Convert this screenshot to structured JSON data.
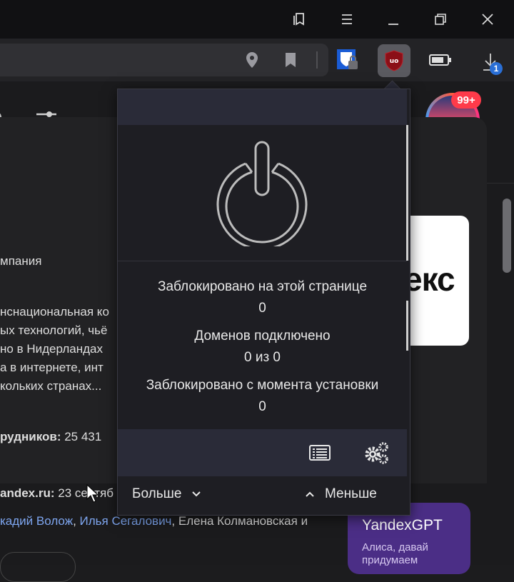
{
  "page": {
    "company_type_fragment": "мпания",
    "desc_lines": [
      "нснациональная ко",
      "ых технологий, чьё",
      "но в Нидерландах",
      "а в интернете, инт",
      "кольких странах..."
    ],
    "employees_label": "рудников:",
    "employees_value": "25 431",
    "site_label": "andex.ru:",
    "site_value": "23 сентяб",
    "founders_link1": "кадий Волож",
    "founders_sep1": ", ",
    "founders_link2": "Илья Сегалович",
    "founders_rest": ", Елена Колмановская и",
    "yandex_logo_fragment": "екс",
    "gpt_title": "YandexGPT",
    "gpt_sub1": "Алиса, давай",
    "gpt_sub2": "придумаем",
    "avatar_badge": "99+",
    "download_badge": "1"
  },
  "popup": {
    "blocked_page_label": "Заблокировано на этой странице",
    "blocked_page_value": "0",
    "domains_label": "Доменов подключено",
    "domains_value": "0 из 0",
    "blocked_total_label": "Заблокировано с момента установки",
    "blocked_total_value": "0",
    "more_label": "Больше",
    "less_label": "Меньше"
  },
  "icons": {
    "titlebar": [
      "collections-icon",
      "menu-icon",
      "minimize-icon",
      "restore-icon",
      "close-icon"
    ],
    "toolbar": [
      "location-icon",
      "bookmark-icon",
      "password-manager-icon",
      "ublock-icon",
      "battery-icon",
      "download-icon"
    ],
    "popup_tools": [
      "logger-icon",
      "dashboard-gears-icon"
    ]
  },
  "colors": {
    "popup_header": "#2a2b38",
    "popup_body": "#1e1e23",
    "ublock_red": "#8b0f17",
    "link": "#7ea6f0",
    "badge": "#ff3b4a",
    "gpt_card": "#4b2e86"
  }
}
